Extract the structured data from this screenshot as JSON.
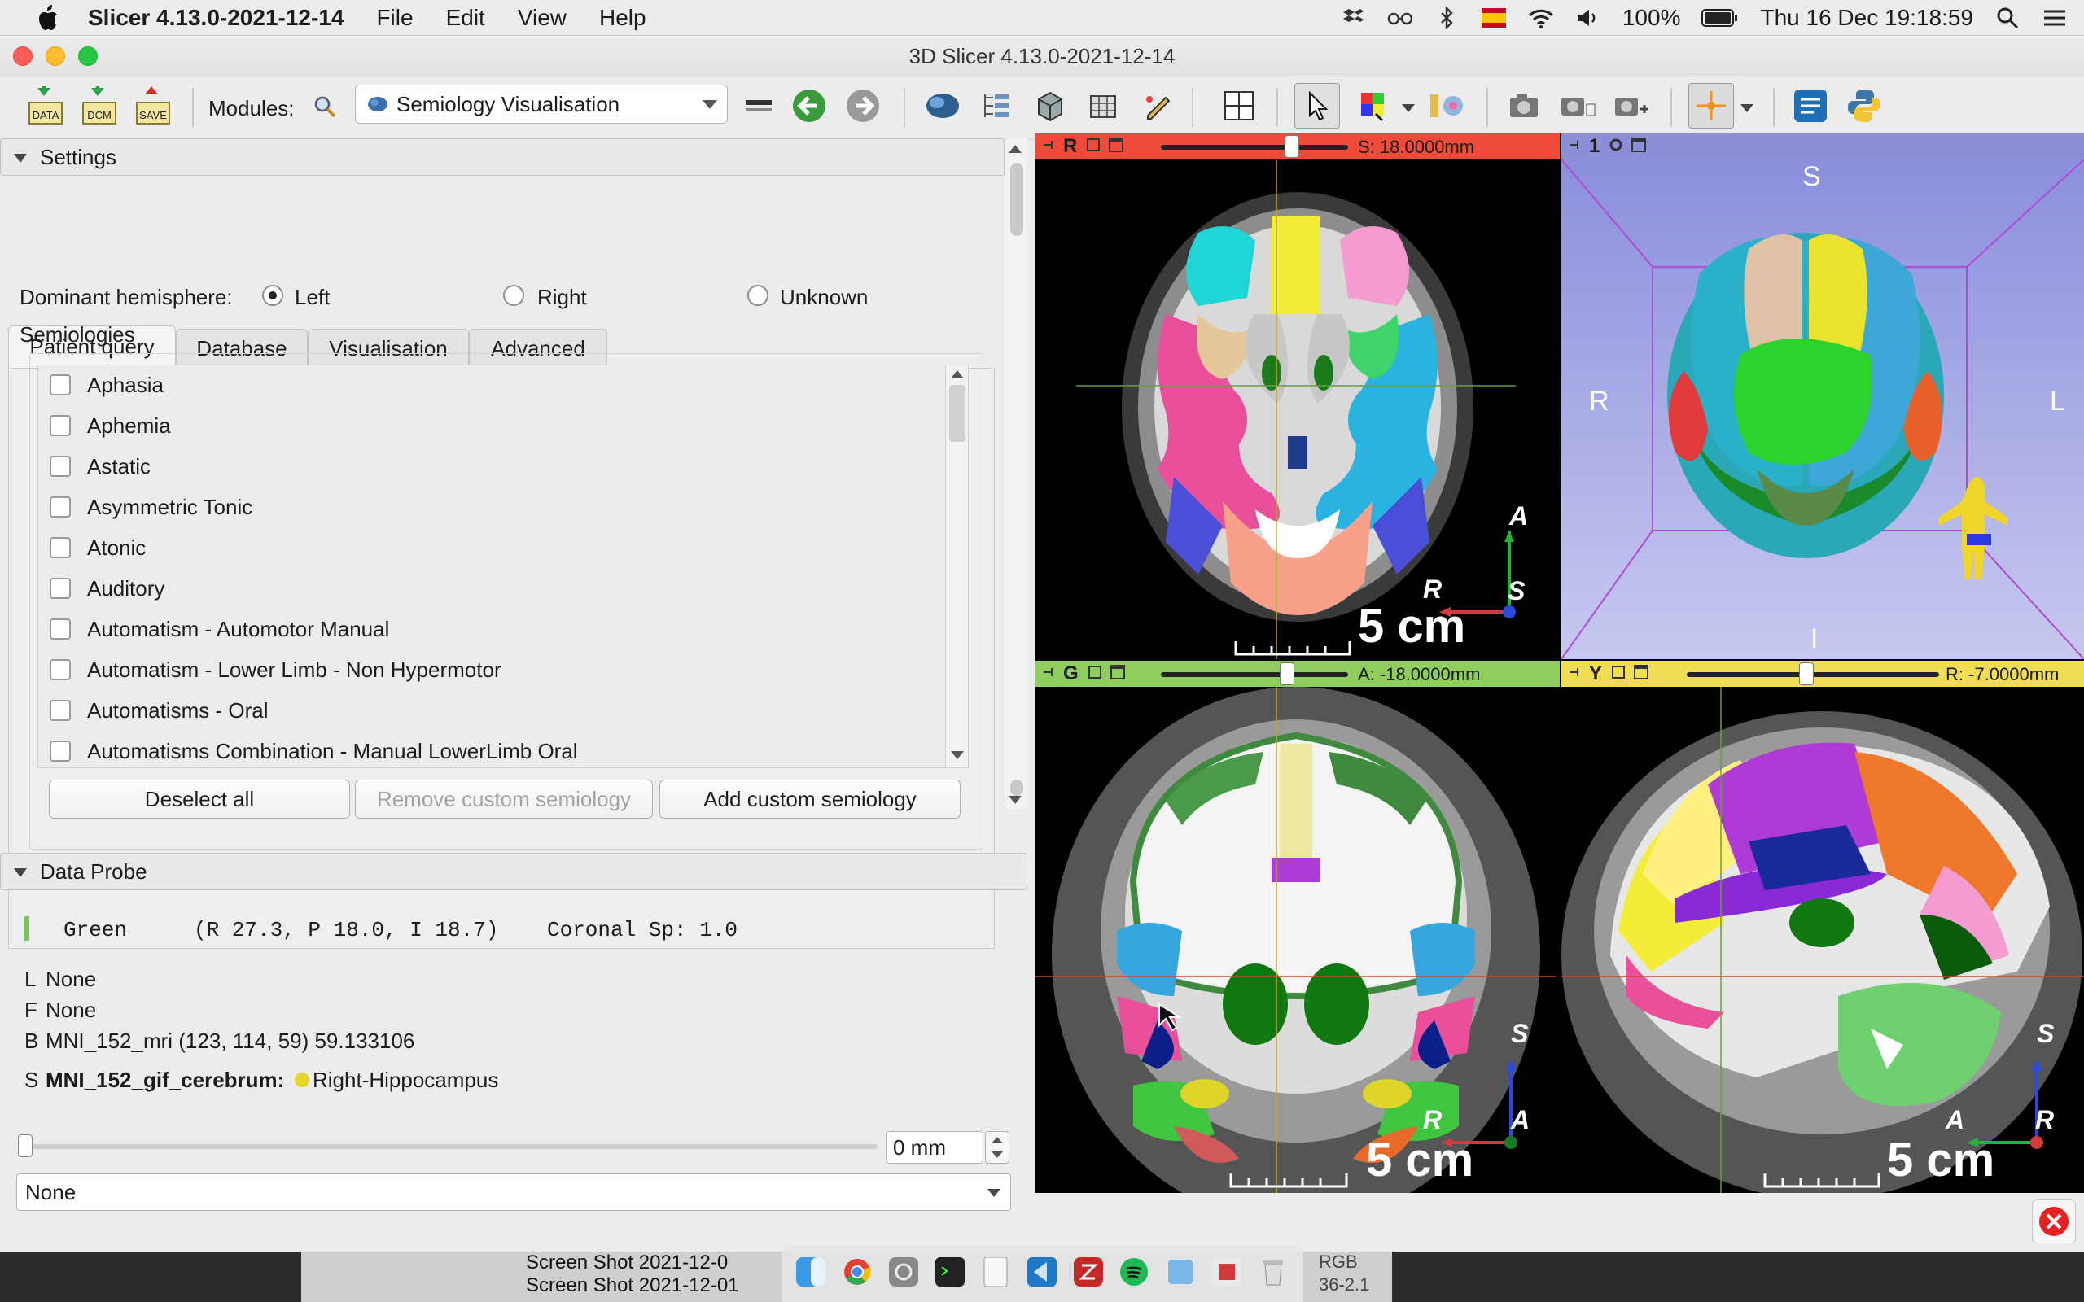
{
  "menubar": {
    "app_name": "Slicer 4.13.0-2021-12-14",
    "items": [
      "File",
      "Edit",
      "View",
      "Help"
    ],
    "battery": "100%",
    "datetime": "Thu 16 Dec  19:18:59"
  },
  "window": {
    "title": "3D Slicer 4.13.0-2021-12-14"
  },
  "toolbar": {
    "data_label": "DATA",
    "dcm_label": "DCM",
    "save_label": "SAVE",
    "modules_label": "Modules:",
    "module_selected": "Semiology Visualisation"
  },
  "settings": {
    "header": "Settings",
    "tabs": [
      "Patient query",
      "Database",
      "Visualisation",
      "Advanced"
    ],
    "dominant_label": "Dominant hemisphere:",
    "hemisphere_options": [
      "Left",
      "Right",
      "Unknown"
    ],
    "semiologies_label": "Semiologies",
    "semiologies": [
      "Aphasia",
      "Aphemia",
      "Astatic",
      "Asymmetric Tonic",
      "Atonic",
      "Auditory",
      "Automatism - Automotor Manual",
      "Automatism - Lower Limb - Non Hypermotor",
      "Automatisms - Oral",
      "Automatisms Combination - Manual LowerLimb Oral"
    ],
    "buttons": {
      "deselect": "Deselect all",
      "remove": "Remove custom semiology",
      "add": "Add custom semiology"
    }
  },
  "probe": {
    "header": "Data Probe",
    "line1_view": "Green",
    "line1_coords": "(R 27.3, P 18.0, I 18.7)",
    "line1_extra": "Coronal Sp: 1.0",
    "l_prefix": "L",
    "l_value": "None",
    "f_prefix": "F",
    "f_value": "None",
    "b_prefix": "B",
    "b_value": "MNI_152_mri (123, 114,  59) 59.133106",
    "s_prefix": "S",
    "s_name": "MNI_152_gif_cerebrum:",
    "s_value": "Right-Hippocampus",
    "slider_value": "0 mm",
    "select_value": "None"
  },
  "views": {
    "red": {
      "letter": "R",
      "value": "S: 18.0000mm",
      "scale": "5 cm",
      "ori": [
        "A",
        "R",
        "S"
      ]
    },
    "threed": {
      "letter": "1",
      "labels": [
        "S",
        "R",
        "L",
        "I"
      ]
    },
    "green": {
      "letter": "G",
      "value": "A: -18.0000mm",
      "scale": "5 cm",
      "ori": [
        "S",
        "R",
        "A"
      ]
    },
    "yellow": {
      "letter": "Y",
      "value": "R: -7.0000mm",
      "scale": "5 cm",
      "ori": [
        "S",
        "A",
        "R"
      ]
    }
  },
  "taskbar": {
    "items": [
      "Screen Shot 2021-12-0",
      "Screen Shot 2021-12-01"
    ],
    "right_labels": [
      "RGB",
      "36-2.1"
    ]
  },
  "colors": {
    "red_view": "#f04a3a",
    "green_view": "#8fcd5e",
    "yellow_view": "#f0dc55",
    "threed_bg": "#8c8fd8"
  }
}
